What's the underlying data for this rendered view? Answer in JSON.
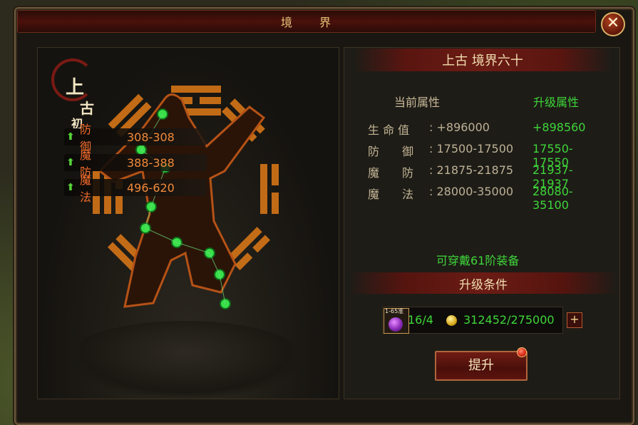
{
  "window": {
    "title": "境　　界",
    "close_label": "✕"
  },
  "left": {
    "brand_chars": [
      "上",
      "古",
      "初"
    ],
    "stats": [
      {
        "name": "防　　御",
        "value": "308-308"
      },
      {
        "name": "魔　　防",
        "value": "388-388"
      },
      {
        "name": "魔　　法",
        "value": "496-620"
      }
    ]
  },
  "right": {
    "realm_title": "上古 境界六十",
    "current_header": "当前属性",
    "upgrade_header": "升级属性",
    "attributes": [
      {
        "label": "生 命 值",
        "current": ": +896000",
        "upgrade": "+898560"
      },
      {
        "label": "防　　御",
        "current": ": 17500-17500",
        "upgrade": "17550-17550"
      },
      {
        "label": "魔　　防",
        "current": ": 21875-21875",
        "upgrade": "21937-21937"
      },
      {
        "label": "魔　　法",
        "current": ": 28000-35000",
        "upgrade": "28080-35100"
      }
    ],
    "equip_note": "可穿戴61阶装备",
    "conditions_title": "升级条件",
    "orb_tag": "1-65准",
    "item_qty": "16/4",
    "gold_amount": "312452/275000",
    "plus_label": "+",
    "upgrade_button": "提升"
  },
  "colors": {
    "accent_green": "#3ed63a",
    "stat_orange": "#f06a2a",
    "title_gold": "#e8c77a"
  },
  "icons": [
    "close-icon",
    "up-arrow-icon",
    "purple-orb-icon",
    "gold-coin-icon",
    "plus-icon",
    "notification-dot-icon"
  ]
}
